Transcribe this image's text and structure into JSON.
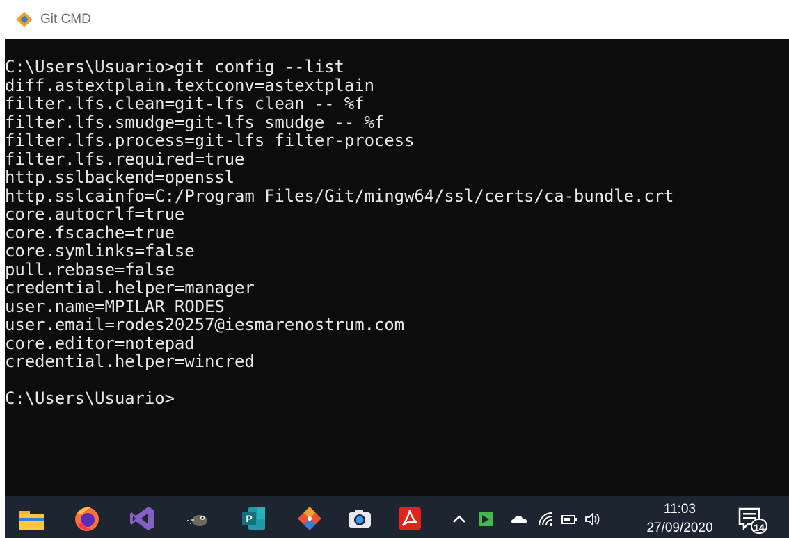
{
  "window": {
    "title": "Git CMD"
  },
  "console": {
    "lines": [
      "C:\\Users\\Usuario>git config --list",
      "diff.astextplain.textconv=astextplain",
      "filter.lfs.clean=git-lfs clean -- %f",
      "filter.lfs.smudge=git-lfs smudge -- %f",
      "filter.lfs.process=git-lfs filter-process",
      "filter.lfs.required=true",
      "http.sslbackend=openssl",
      "http.sslcainfo=C:/Program Files/Git/mingw64/ssl/certs/ca-bundle.crt",
      "core.autocrlf=true",
      "core.fscache=true",
      "core.symlinks=false",
      "pull.rebase=false",
      "credential.helper=manager",
      "user.name=MPILAR RODES",
      "user.email=rodes20257@iesmarenostrum.com",
      "core.editor=notepad",
      "credential.helper=wincred",
      "",
      "C:\\Users\\Usuario>"
    ]
  },
  "taskbar": {
    "pinned": [
      "file-explorer-icon",
      "firefox-icon",
      "visual-studio-icon",
      "gimp-icon",
      "powerpoint-icon",
      "git-icon",
      "camera-icon",
      "acrobat-reader-icon"
    ],
    "tray": [
      "chevron-up-icon",
      "green-app-icon",
      "onedrive-cloud-icon",
      "wifi-icon",
      "battery-icon",
      "volume-icon"
    ],
    "clock": {
      "time": "11:03",
      "date": "27/09/2020"
    },
    "notifications": {
      "icon": "action-center-icon",
      "count": "14"
    }
  },
  "colors": {
    "console_bg": "#0c0c0c",
    "console_fg": "#e8e8e8",
    "taskbar_bg": "#1d2530",
    "git_orange": "#f05133"
  }
}
